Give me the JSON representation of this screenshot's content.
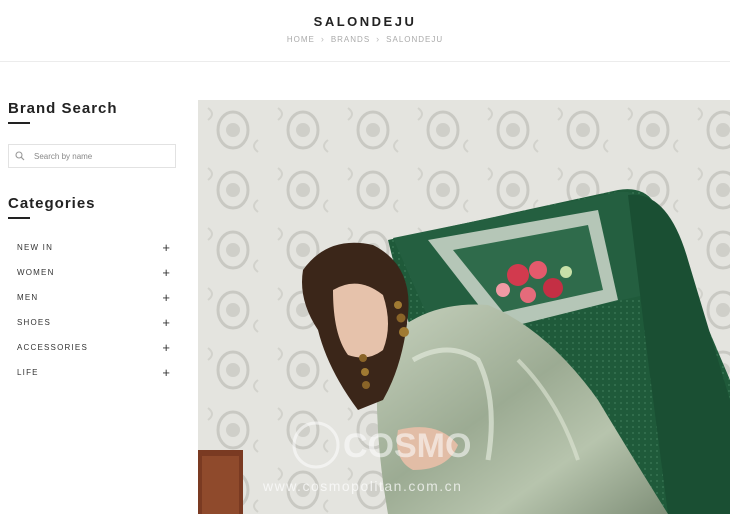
{
  "header": {
    "title": "SALONDEJU",
    "breadcrumb": [
      {
        "label": "HOME"
      },
      {
        "label": "BRANDS"
      },
      {
        "label": "SALONDEJU"
      }
    ],
    "separator": "›"
  },
  "sidebar": {
    "brand_search": {
      "heading": "Brand Search",
      "placeholder": "Search by name",
      "value": "",
      "icon": "search-icon"
    },
    "categories": {
      "heading": "Categories",
      "expand_icon": "+",
      "items": [
        {
          "label": "NEW IN"
        },
        {
          "label": "WOMEN"
        },
        {
          "label": "MEN"
        },
        {
          "label": "SHOES"
        },
        {
          "label": "ACCESSORIES"
        },
        {
          "label": "LIFE"
        }
      ]
    }
  },
  "hero": {
    "description_icon": "photo-model-on-green-armchair",
    "watermark_logo": "COSMO",
    "watermark_url": "www.cosmopolitan.com.cn"
  },
  "colors": {
    "text": "#222222",
    "muted": "#aaaaaa",
    "border": "#e2e2e2",
    "chair_green": "#1f5a3a",
    "dress_sage": "#a9b8a0"
  }
}
